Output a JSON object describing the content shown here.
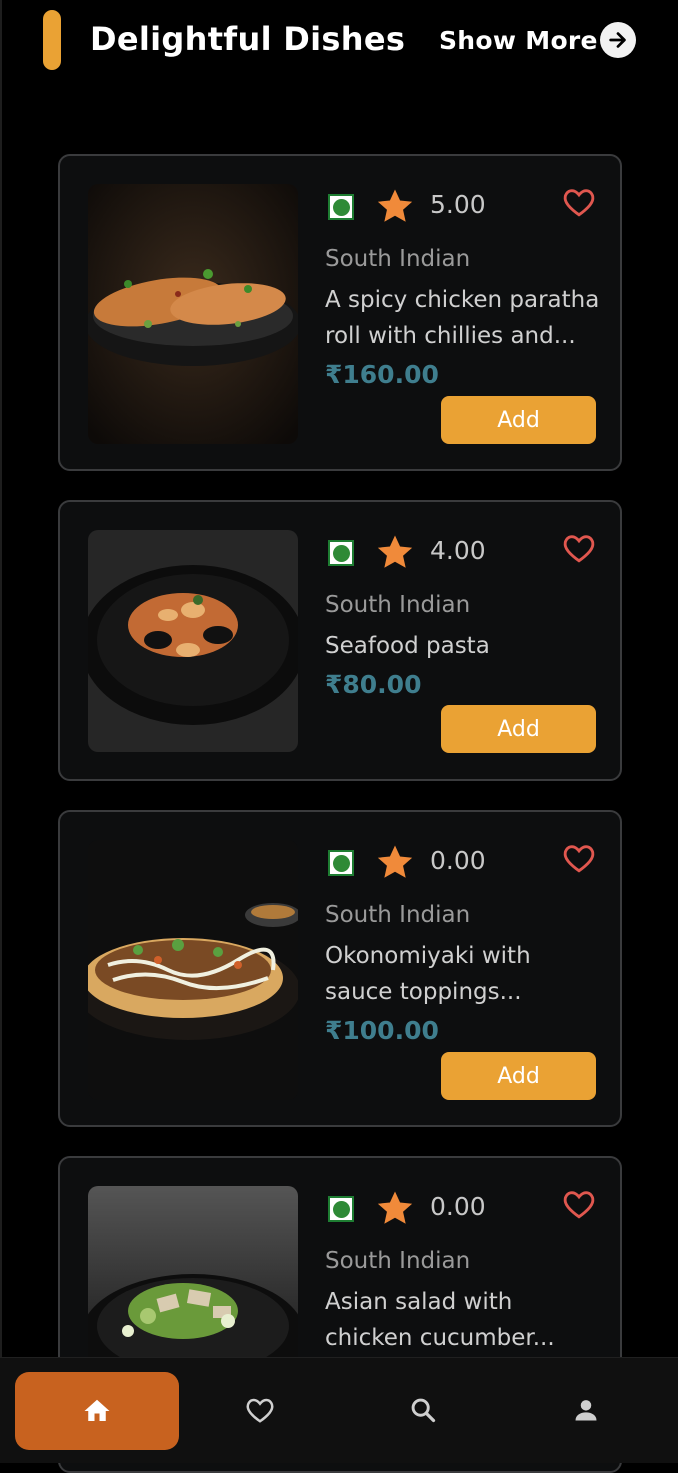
{
  "header": {
    "title": "Delightful Dishes",
    "show_more_label": "Show More"
  },
  "colors": {
    "accent": "#EAA234",
    "price": "#3F7E8E",
    "heart": "#E0574F",
    "nav_active": "#C8621F",
    "star": "#F08A3A"
  },
  "dishes": [
    {
      "rating": "5.00",
      "cuisine": "South Indian",
      "description": "A spicy chicken paratha roll with chillies and...",
      "price": "₹160.00",
      "add_label": "Add",
      "image": "paratha-roll-image",
      "veg_icon": "veg-indicator-icon"
    },
    {
      "rating": "4.00",
      "cuisine": "South Indian",
      "description": "Seafood pasta",
      "price": "₹80.00",
      "add_label": "Add",
      "image": "seafood-pasta-image",
      "veg_icon": "veg-indicator-icon"
    },
    {
      "rating": "0.00",
      "cuisine": "South Indian",
      "description": "Okonomiyaki with sauce toppings...",
      "price": "₹100.00",
      "add_label": "Add",
      "image": "okonomiyaki-image",
      "veg_icon": "veg-indicator-icon"
    },
    {
      "rating": "0.00",
      "cuisine": "South Indian",
      "description": "Asian salad with chicken cucumber...",
      "price": "",
      "add_label": "",
      "image": "asian-salad-image",
      "veg_icon": "veg-indicator-icon"
    }
  ],
  "bottom_nav": {
    "items": [
      {
        "icon": "home-icon",
        "active": true
      },
      {
        "icon": "heart-icon",
        "active": false
      },
      {
        "icon": "search-icon",
        "active": false
      },
      {
        "icon": "profile-icon",
        "active": false
      }
    ]
  }
}
